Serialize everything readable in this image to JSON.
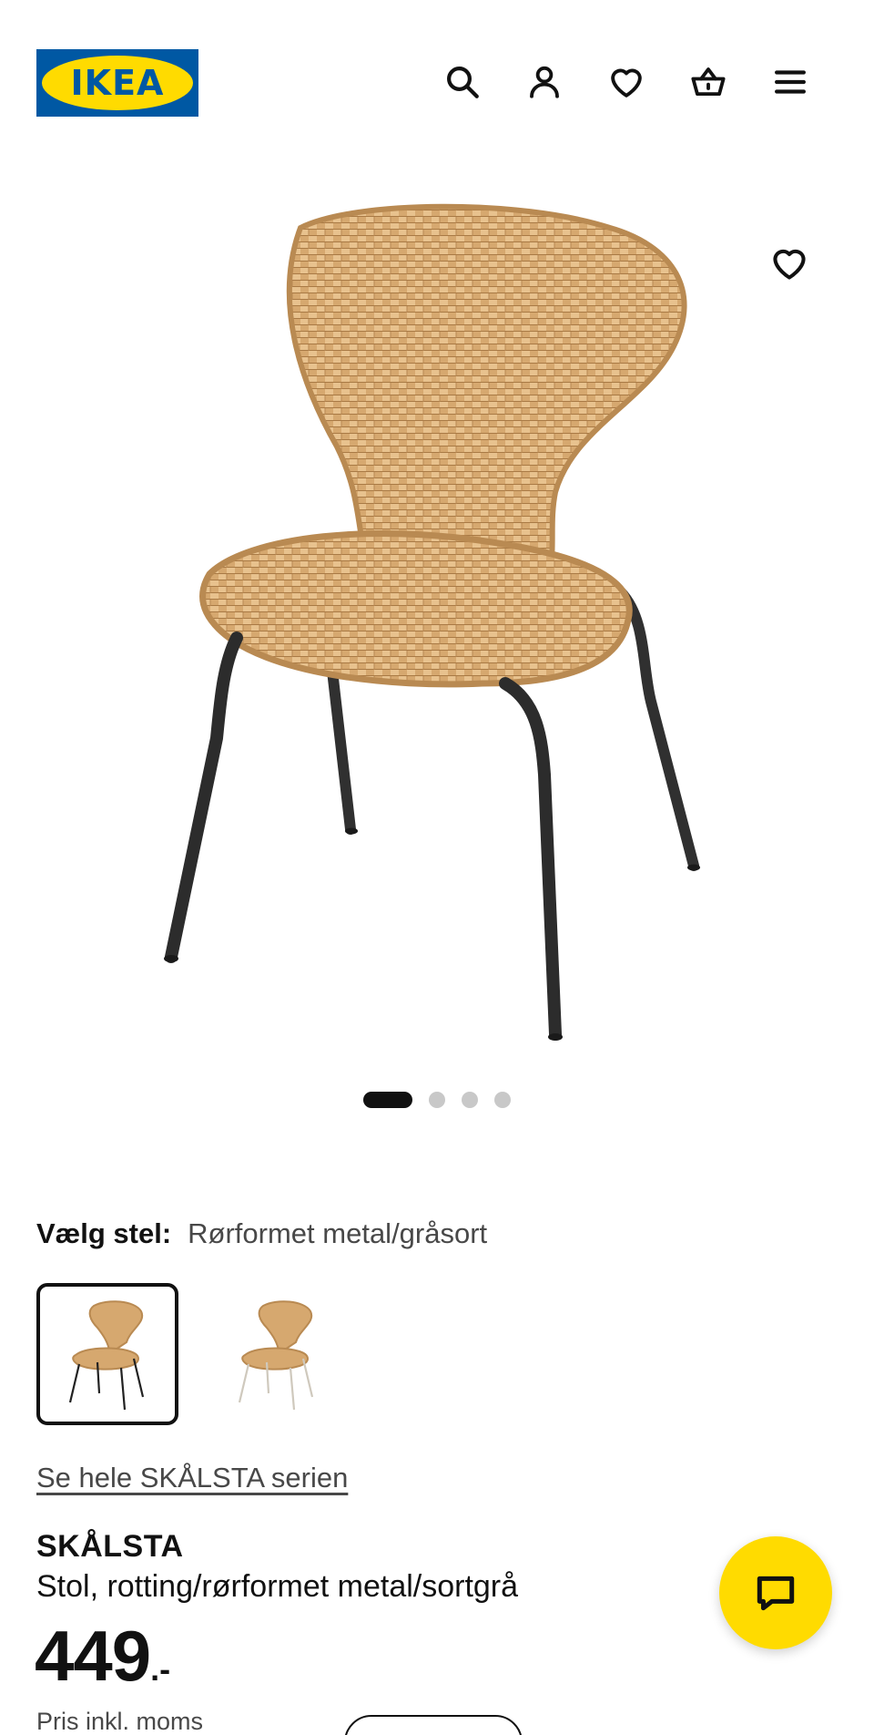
{
  "header": {
    "logo_text": "IKEA",
    "icons": [
      "search-icon",
      "account-icon",
      "heart-icon",
      "cart-icon",
      "menu-icon"
    ]
  },
  "gallery": {
    "image_count": 4,
    "active_index": 0,
    "favorite_icon": "heart-icon"
  },
  "variant": {
    "label": "Vælg stel:",
    "value": "Rørformet metal/gråsort",
    "options": [
      {
        "name": "dark-frame",
        "selected": true
      },
      {
        "name": "light-frame",
        "selected": false
      }
    ]
  },
  "series_link": "Se hele SKÅLSTA serien",
  "product": {
    "name": "SKÅLSTA",
    "description": "Stol, rotting/rørformet metal/sortgrå",
    "price_integer": "449",
    "price_suffix": ".-",
    "vat_note": "Pris inkl. moms"
  },
  "chat_button": {
    "icon": "chat-icon"
  },
  "colors": {
    "brand_blue": "#0058a3",
    "brand_yellow": "#ffdb00",
    "rattan": "#d4a36a",
    "frame_dark": "#333333",
    "frame_light": "#cfc9bd"
  }
}
